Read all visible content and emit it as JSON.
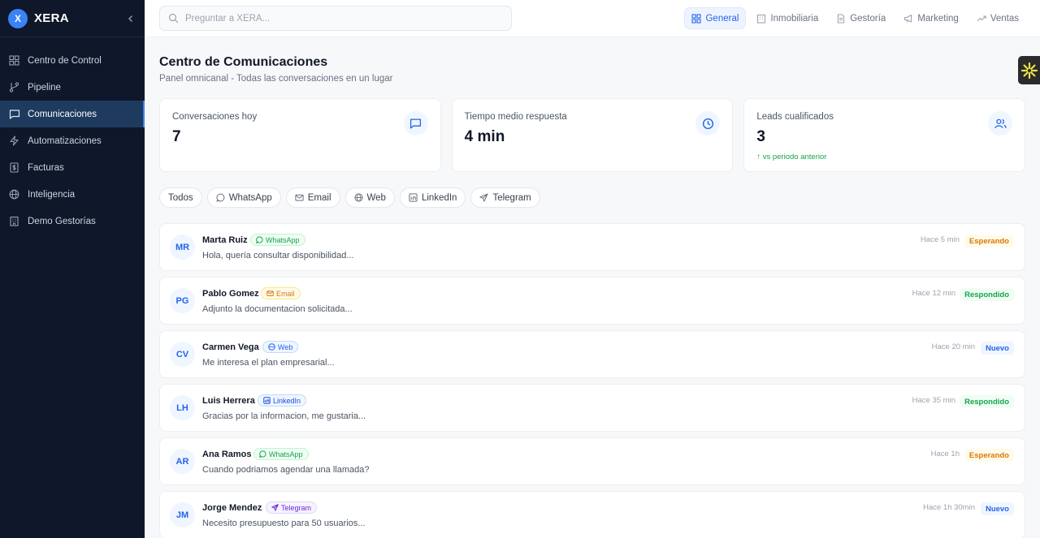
{
  "brand": {
    "logo_letter": "X",
    "name": "XERA"
  },
  "sidebar": {
    "items": [
      {
        "label": "Centro de Control",
        "icon": "grid-icon",
        "active": false
      },
      {
        "label": "Pipeline",
        "icon": "git-branch-icon",
        "active": false
      },
      {
        "label": "Comunicaciones",
        "icon": "message-square-icon",
        "active": true
      },
      {
        "label": "Automatizaciones",
        "icon": "zap-icon",
        "active": false
      },
      {
        "label": "Facturas",
        "icon": "receipt-icon",
        "active": false
      },
      {
        "label": "Inteligencia",
        "icon": "globe-icon",
        "active": false
      },
      {
        "label": "Demo Gestorías",
        "icon": "building-icon",
        "active": false
      }
    ]
  },
  "search": {
    "placeholder": "Preguntar a XERA..."
  },
  "tabs": [
    {
      "label": "General",
      "active": true
    },
    {
      "label": "Inmobiliaria",
      "active": false
    },
    {
      "label": "Gestoría",
      "active": false
    },
    {
      "label": "Marketing",
      "active": false
    },
    {
      "label": "Ventas",
      "active": false
    }
  ],
  "page": {
    "title": "Centro de Comunicaciones",
    "subtitle": "Panel omnicanal - Todas las conversaciones en un lugar"
  },
  "stats": [
    {
      "label": "Conversaciones hoy",
      "value": "7",
      "trend": ""
    },
    {
      "label": "Tiempo medio respuesta",
      "value": "4 min",
      "trend": ""
    },
    {
      "label": "Leads cualificados",
      "value": "3",
      "trend": "↑ vs periodo anterior"
    }
  ],
  "filters": [
    "Todos",
    "WhatsApp",
    "Email",
    "Web",
    "LinkedIn",
    "Telegram"
  ],
  "conversations": [
    {
      "initials": "MR",
      "name": "Marta Ruiz",
      "channel": "WhatsApp",
      "message": "Hola, quería consultar disponibilidad...",
      "time": "Hace 5 min",
      "status": "Esperando"
    },
    {
      "initials": "PG",
      "name": "Pablo Gomez",
      "channel": "Email",
      "message": "Adjunto la documentacion solicitada...",
      "time": "Hace 12 min",
      "status": "Respondido"
    },
    {
      "initials": "CV",
      "name": "Carmen Vega",
      "channel": "Web",
      "message": "Me interesa el plan empresarial...",
      "time": "Hace 20 min",
      "status": "Nuevo"
    },
    {
      "initials": "LH",
      "name": "Luis Herrera",
      "channel": "LinkedIn",
      "message": "Gracias por la informacion, me gustaria...",
      "time": "Hace 35 min",
      "status": "Respondido"
    },
    {
      "initials": "AR",
      "name": "Ana Ramos",
      "channel": "WhatsApp",
      "message": "Cuando podriamos agendar una llamada?",
      "time": "Hace 1h",
      "status": "Esperando"
    },
    {
      "initials": "JM",
      "name": "Jorge Mendez",
      "channel": "Telegram",
      "message": "Necesito presupuesto para 50 usuarios...",
      "time": "Hace 1h 30min",
      "status": "Nuevo"
    }
  ],
  "colors": {
    "sidebar_bg": "#0f172a",
    "accent": "#2563eb",
    "active_nav": "#1e3a5f"
  }
}
